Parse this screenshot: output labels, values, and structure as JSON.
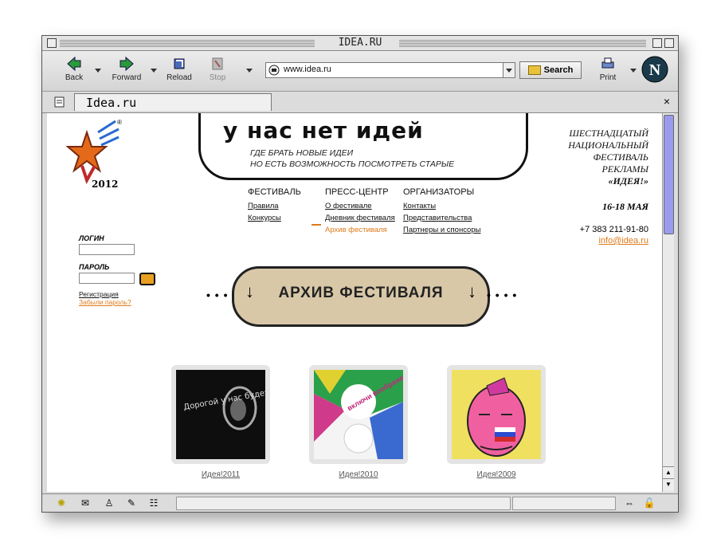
{
  "window": {
    "title": "IDEA.RU"
  },
  "toolbar": {
    "back_label": "Back",
    "forward_label": "Forward",
    "reload_label": "Reload",
    "stop_label": "Stop",
    "url": "www.idea.ru",
    "search_label": "Search",
    "print_label": "Print"
  },
  "tab": {
    "label": "Idea.ru",
    "close": "×"
  },
  "site": {
    "logo_year": "2012",
    "banner_title": "у нас нет идей",
    "banner_line1": "ГДЕ БРАТЬ НОВЫЕ ИДЕИ",
    "banner_line2": "НО ЕСТЬ ВОЗМОЖНОСТЬ ПОСМОТРЕТЬ СТАРЫЕ",
    "menu": [
      {
        "heading": "ФЕСТИВАЛЬ",
        "items": [
          "Правила",
          "Конкурсы"
        ]
      },
      {
        "heading": "ПРЕСС-ЦЕНТР",
        "items": [
          "О фестивале",
          "Дневник фестиваля",
          "Архив фестиваля"
        ]
      },
      {
        "heading": "ОРГАНИЗАТОРЫ",
        "items": [
          "Контакты",
          "Представительства",
          "Партнеры и спонсоры"
        ]
      }
    ],
    "festival_info": [
      "ШЕСТНАДЦАТЫЙ",
      "НАЦИОНАЛЬНЫЙ",
      "ФЕСТИВАЛЬ",
      "РЕКЛАМЫ",
      "«ИДЕЯ!»"
    ],
    "dates": "16-18 МАЯ",
    "phone": "+7 383 211-91-80",
    "email": "info@idea.ru",
    "login": {
      "login_label": "ЛОГИН",
      "password_label": "ПАРОЛЬ",
      "register": "Регистрация",
      "forgot": "Забыли пароль?"
    },
    "archive_title": "АРХИВ ФЕСТИВАЛЯ",
    "archive_items": [
      {
        "caption": "Идея!2011",
        "img_text": "Дорогой у нас будет идея!"
      },
      {
        "caption": "Идея!2010",
        "img_text": "включи воображение"
      },
      {
        "caption": "Идея!2009",
        "img_text": ""
      }
    ]
  },
  "colors": {
    "accent": "#e07a1a",
    "archive_bg": "#d8c8a8",
    "scroll_thumb": "#9a9aee"
  }
}
